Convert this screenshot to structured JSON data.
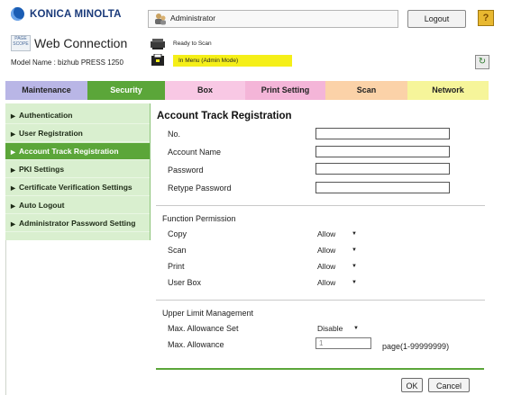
{
  "header": {
    "brand": "KONICA MINOLTA",
    "app_title": "Web Connection",
    "page_scope_badge": "PAGE SCOPE",
    "model_label": "Model Name : bizhub PRESS 1250",
    "user": "Administrator",
    "logout_label": "Logout",
    "help_label": "?",
    "status_ready": "Ready to Scan",
    "status_menu": "In Menu (Admin Mode)",
    "refresh_icon": "refresh-icon"
  },
  "tabs": [
    {
      "label": "Maintenance",
      "color": "#b9b6e6"
    },
    {
      "label": "Security",
      "color": "#5ba639",
      "text_color": "#ffffff"
    },
    {
      "label": "Box",
      "color": "#f8c8e4"
    },
    {
      "label": "Print Setting",
      "color": "#f4b5d8"
    },
    {
      "label": "Scan",
      "color": "#fbd2a8"
    },
    {
      "label": "Network",
      "color": "#f6f59a"
    }
  ],
  "sidebar": {
    "items": [
      {
        "label": "Authentication"
      },
      {
        "label": "User Registration"
      },
      {
        "label": "Account Track Registration",
        "active": true
      },
      {
        "label": "PKI Settings"
      },
      {
        "label": "Certificate Verification Settings"
      },
      {
        "label": "Auto Logout"
      },
      {
        "label": "Administrator Password Setting"
      }
    ]
  },
  "main": {
    "title": "Account Track Registration",
    "fields": [
      {
        "label": "No.",
        "value": ""
      },
      {
        "label": "Account Name",
        "value": ""
      },
      {
        "label": "Password",
        "value": ""
      },
      {
        "label": "Retype Password",
        "value": ""
      }
    ],
    "function_permission": {
      "heading": "Function Permission",
      "rows": [
        {
          "label": "Copy",
          "value": "Allow"
        },
        {
          "label": "Scan",
          "value": "Allow"
        },
        {
          "label": "Print",
          "value": "Allow"
        },
        {
          "label": "User Box",
          "value": "Allow"
        }
      ]
    },
    "upper_limit": {
      "heading": "Upper Limit Management",
      "max_set_label": "Max. Allowance Set",
      "max_set_value": "Disable",
      "max_allow_label": "Max. Allowance",
      "max_allow_value": "1",
      "max_allow_unit": "page(1-99999999)"
    },
    "ok_label": "OK",
    "cancel_label": "Cancel"
  }
}
